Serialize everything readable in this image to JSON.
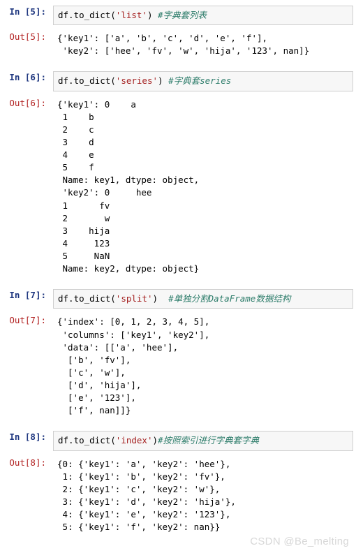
{
  "cells": [
    {
      "in_prompt": "In  [5]:",
      "out_prompt": "Out[5]:",
      "code_prefix": "df.to_dict(",
      "code_arg": "'list'",
      "code_suffix": ") ",
      "code_comment": "#字典套列表",
      "output": "{'key1': ['a', 'b', 'c', 'd', 'e', 'f'],\n 'key2': ['hee', 'fv', 'w', 'hija', '123', nan]}"
    },
    {
      "in_prompt": "In  [6]:",
      "out_prompt": "Out[6]:",
      "code_prefix": "df.to_dict(",
      "code_arg": "'series'",
      "code_suffix": ") ",
      "code_comment": "#字典套series",
      "output": "{'key1': 0    a\n 1    b\n 2    c\n 3    d\n 4    e\n 5    f\n Name: key1, dtype: object,\n 'key2': 0     hee\n 1      fv\n 2       w\n 3    hija\n 4     123\n 5     NaN\n Name: key2, dtype: object}"
    },
    {
      "in_prompt": "In  [7]:",
      "out_prompt": "Out[7]:",
      "code_prefix": "df.to_dict(",
      "code_arg": "'split'",
      "code_suffix": ")  ",
      "code_comment": "#单独分割DataFrame数据结构",
      "output": "{'index': [0, 1, 2, 3, 4, 5],\n 'columns': ['key1', 'key2'],\n 'data': [['a', 'hee'],\n  ['b', 'fv'],\n  ['c', 'w'],\n  ['d', 'hija'],\n  ['e', '123'],\n  ['f', nan]]}"
    },
    {
      "in_prompt": "In  [8]:",
      "out_prompt": "Out[8]:",
      "code_prefix": "df.to_dict(",
      "code_arg": "'index'",
      "code_suffix": ")",
      "code_comment": "#按照索引进行字典套字典",
      "output": "{0: {'key1': 'a', 'key2': 'hee'},\n 1: {'key1': 'b', 'key2': 'fv'},\n 2: {'key1': 'c', 'key2': 'w'},\n 3: {'key1': 'd', 'key2': 'hija'},\n 4: {'key1': 'e', 'key2': '123'},\n 5: {'key1': 'f', 'key2': nan}}"
    }
  ],
  "watermark": "CSDN @Be_melting"
}
